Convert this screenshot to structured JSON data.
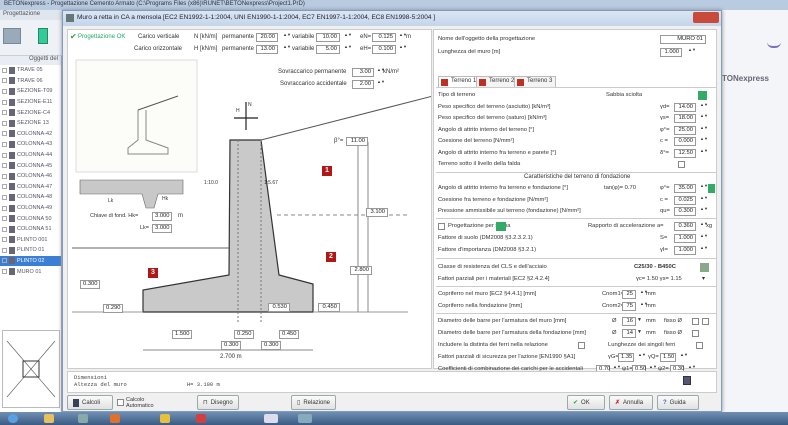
{
  "app": {
    "title": "BETONexpress - Progettazione Cemento Armato (C:\\Programs Files (x86)\\RUNET\\BETONexpress\\Project1.PrD)",
    "menu": "Progettazione",
    "side_title": "TONexpress",
    "tree_header": "Oggetti del",
    "tree_items": [
      "TRAVE 05",
      "TRAVE 06",
      "SEZIONE-T09",
      "SEZIONE-E11",
      "SEZIONE-C4",
      "SEZIONE 13",
      "COLONNA-42",
      "COLONNA-43",
      "COLONNA-44",
      "COLONNA-45",
      "COLONNA-46",
      "COLONNA-47",
      "COLONNA-48",
      "COLONNA-49",
      "COLONNA 50",
      "COLONNA 51",
      "PLINTO 001",
      "PLINTO 01",
      "PLINTO 02",
      "MURO 01"
    ],
    "tree_selected": 18
  },
  "dialog": {
    "title": "Muro a retta in CA a mensola [EC2 EN1992-1-1:2004, UNI EN1990-1-1:2004, EC7 EN1997-1-1:2004, EC8 EN1998-5:2004 ]",
    "status": "Progettazione OK",
    "loads": {
      "vert_label": "Carico verticale",
      "vert_unit": "N [kN/m]",
      "perm_label": "permanente",
      "var_label": "variabile",
      "vert_perm": "20.00",
      "vert_var": "10.00",
      "ev_label": "eN=",
      "ev": "0.125",
      "ev_unit": "m",
      "hor_label": "Carico orizzontale",
      "hor_unit": "H [kN/m]",
      "hor_perm": "13.00",
      "hor_var": "5.00",
      "eh_label": "eH=",
      "eh": "0.100"
    },
    "surcharge": {
      "perm_label": "Sovraccarico permanente",
      "perm": "3.00",
      "unit": "kN/m²",
      "acc_label": "Sovraccarico accidentale",
      "acc": "2.00"
    },
    "drawing": {
      "beta_label": "β°=",
      "beta": "11.00",
      "h1": "3.100",
      "h2": "2.800",
      "toe_h": "0.450",
      "heel_h": "0.530",
      "front_h": "0.300",
      "front_t": "0.290",
      "b1": "1.500",
      "b2": "0.250",
      "b3": "0.450",
      "b4": "0.300",
      "b5": "0.300",
      "total": "2.700 m",
      "slope_l": "1:10.0",
      "slope_r": "1:5.67",
      "unit_m": "m",
      "regions": [
        "1",
        "2",
        "3"
      ],
      "key_label": "Chiave di fond. Hk=",
      "key_h": "3.000",
      "key_l_label": "Lk=",
      "key_l": "3.000",
      "Lk": "Lk",
      "Hk": "Hk",
      "N": "N",
      "H": "H"
    }
  },
  "form": {
    "name_label": "Nome dell'oggetto della progettazione",
    "name": "MURO 01",
    "length_label": "Lunghezza del muro [m]",
    "length": "1.000",
    "tabs": [
      "Terreno 1",
      "Terreno 2",
      "Terreno 3"
    ],
    "soil": [
      {
        "label": "Tipo di terreno",
        "value": "Sabbia sciolta"
      },
      {
        "label": "Peso specifico del terreno (asciutto) [kN/m³]",
        "sym": "γd=",
        "value": "14.00"
      },
      {
        "label": "Peso specifico del terreno (saturo) [kN/m³]",
        "sym": "γs=",
        "value": "18.00"
      },
      {
        "label": "Angolo di attrito interno del terreno [°]",
        "sym": "φ°=",
        "value": "25.00"
      },
      {
        "label": "Coesione del terreno [N/mm²]",
        "sym": "c =",
        "value": "0.000"
      },
      {
        "label": "Angolo di attrito interno fra terreno e parete [°]",
        "sym": "δ°=",
        "value": "12.50"
      },
      {
        "label": "Terreno sotto il livello della falda"
      }
    ],
    "found_header": "Caratteristiche del terreno di fondazione",
    "found": [
      {
        "label": "Angolo di attrito interno fra terreno e fondazione [°]",
        "extra": "tan(φ)= 0.70",
        "sym": "φ°=",
        "value": "35.00"
      },
      {
        "label": "Coesione fra terreno e fondazione [N/mm²]",
        "sym": "c =",
        "value": "0.025"
      },
      {
        "label": "Pressione ammissibile sul terreno (fondazione) [N/mm²]",
        "sym": "qu=",
        "value": "0.300"
      }
    ],
    "seismic": {
      "label": "Progettazione per sisma",
      "ratio_label": "Rapporto di accelerazione a=",
      "ratio": "0.360",
      "ratio_unit": "xg",
      "soil_label": "Fattore di suolo (DM2008 §3.2.3.2.1)",
      "soil_sym": "S=",
      "soil": "1.000",
      "imp_label": "Fattore d'importanza (DM2008 §3.2.1)",
      "imp_sym": "γI=",
      "imp": "1.000"
    },
    "materials": {
      "class_label": "Classe di resistenza del CLS e dell'acciaio",
      "class": "C25/30 - B450C",
      "partial_label": "Fattori parziali per i materiali [EC2 §2.4.2.4]",
      "partial": "γc= 1.50  γs= 1.15"
    },
    "cover": {
      "wall_label": "Copriferro nel muro [EC2 §4.4.1] [mm]",
      "wall_sym": "Cnom1=",
      "wall": "25",
      "found_label": "Copriferro nella fondazione [mm]",
      "found_sym": "Cnom2=",
      "found": "75",
      "unit": "mm"
    },
    "bars": {
      "wall_label": "Diametro delle barre per l'armatura del muro [mm]",
      "wall": "16",
      "found_label": "Diametro delle barre per l'armatura della fondazione [mm]",
      "found": "14",
      "unit": "mm",
      "fixed": "fisso Ø"
    },
    "include_label": "Includere la distinta dei ferri nella relazione",
    "length_bars_label": "Lunghezze dei singoli ferri",
    "safety": {
      "label": "Fattori parziali di sicurezza per l'azione [EN1990 §A1]",
      "g_sym": "γG=",
      "g": "1.35",
      "q_sym": "γQ=",
      "q": "1.50"
    },
    "comb": {
      "label": "Coefficienti di combinazione dei carichi per le accidentali",
      "v0": "0.70",
      "s1": "ψ1=",
      "v1": "0.50",
      "s2": "ψ2=",
      "v2": "0.30"
    }
  },
  "notes": {
    "line1": "Dimensioni",
    "line2_label": "Altezza del muro",
    "line2_value": "H= 3.100 m"
  },
  "buttons": {
    "calc": "Calcoli",
    "auto": "Calcolo Automatico",
    "drawing": "Disegno",
    "report": "Relazione",
    "ok": "OK",
    "cancel": "Annulla",
    "help": "Guida"
  }
}
